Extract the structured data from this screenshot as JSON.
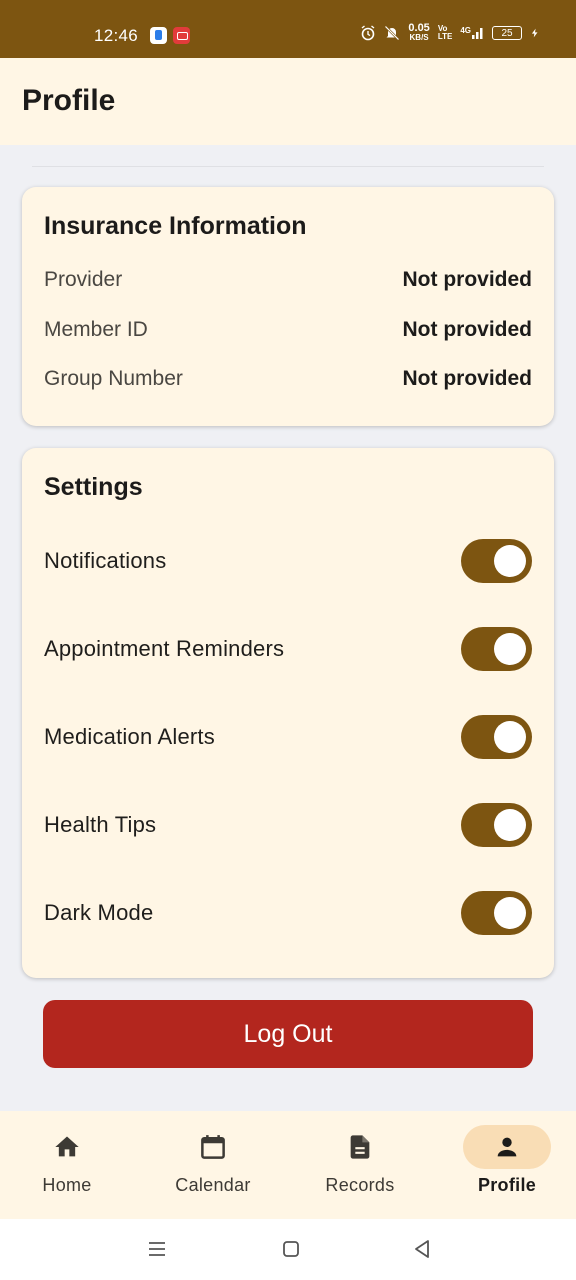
{
  "status_bar": {
    "time": "12:46",
    "net_speed_value": "0.05",
    "net_speed_unit": "KB/S",
    "volte_top": "Vo",
    "volte_bottom": "LTE",
    "signal_label": "4G",
    "battery_level": "25",
    "icons": [
      "app-notification-icon",
      "screen-record-icon",
      "alarm-icon",
      "mute-icon",
      "signal-icon",
      "battery-icon",
      "charging-icon"
    ]
  },
  "header": {
    "title": "Profile"
  },
  "insurance": {
    "title": "Insurance Information",
    "rows": [
      {
        "label": "Provider",
        "value": "Not provided"
      },
      {
        "label": "Member ID",
        "value": "Not provided"
      },
      {
        "label": "Group Number",
        "value": "Not provided"
      }
    ]
  },
  "settings": {
    "title": "Settings",
    "items": [
      {
        "label": "Notifications",
        "enabled": true
      },
      {
        "label": "Appointment Reminders",
        "enabled": true
      },
      {
        "label": "Medication Alerts",
        "enabled": true
      },
      {
        "label": "Health Tips",
        "enabled": true
      },
      {
        "label": "Dark Mode",
        "enabled": true
      }
    ]
  },
  "logout": {
    "label": "Log Out"
  },
  "bottom_nav": {
    "items": [
      {
        "label": "Home",
        "icon": "home-icon",
        "active": false
      },
      {
        "label": "Calendar",
        "icon": "calendar-icon",
        "active": false
      },
      {
        "label": "Records",
        "icon": "document-icon",
        "active": false
      },
      {
        "label": "Profile",
        "icon": "person-icon",
        "active": true
      }
    ]
  },
  "colors": {
    "brand": "#7d5511",
    "surface": "#fff6e5",
    "background": "#eff0f4",
    "danger": "#b3261e",
    "active_nav_pill": "#f9ddb5"
  }
}
